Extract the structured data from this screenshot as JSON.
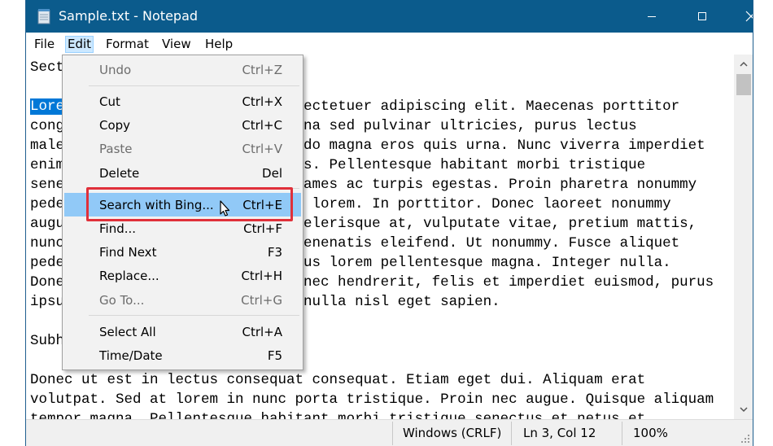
{
  "window": {
    "title": "Sample.txt - Notepad",
    "icon": "notepad-icon",
    "controls": {
      "minimize": "minimize-icon",
      "maximize": "maximize-icon",
      "close": "close-icon"
    }
  },
  "menubar": {
    "items": [
      {
        "label": "File"
      },
      {
        "label": "Edit",
        "active": true
      },
      {
        "label": "Format"
      },
      {
        "label": "View"
      },
      {
        "label": "Help"
      }
    ]
  },
  "editor": {
    "lines": [
      "Sect",
      "",
      "Lorem ipsum dolor sit amet, consectetuer adipiscing elit. Maecenas porttitor",
      "congue massa. Fusce posuere, magna sed pulvinar ultricies, purus lectus",
      "malesuada libero, sit amet commodo magna eros quis urna. Nunc viverra imperdiet",
      "enim. Fusce est. Vivamus a tellus. Pellentesque habitant morbi tristique",
      "senectus et netus et malesuada fames ac turpis egestas. Proin pharetra nonummy",
      "pede. Mauris et orci. Aenean nec lorem. In porttitor. Donec laoreet nonummy",
      "augue. Suspendisse dui purus, scelerisque at, vulputate vitae, pretium mattis,",
      "nunc. Mauris eget neque at sem venenatis eleifend. Ut nonummy. Fusce aliquet",
      "pede non pede. Suspendisse dapibus lorem pellentesque magna. Integer nulla.",
      "Donec blandit feugiat ligula. Donec hendrerit, felis et imperdiet euismod, purus",
      "ipsum pretium metus, in lacinia nulla nisl eget sapien.",
      "",
      "Subh",
      "",
      "Donec ut est in lectus consequat consequat. Etiam eget dui. Aliquam erat",
      "volutpat. Sed at lorem in nunc porta tristique. Proin nec augue. Quisque aliquam",
      "tempor magna. Pellentesque habitant morbi tristique senectus et netus et"
    ],
    "selected_text": "Lore"
  },
  "edit_menu": {
    "items": [
      {
        "label": "Undo",
        "shortcut": "Ctrl+Z",
        "disabled": true
      },
      {
        "label": "Cut",
        "shortcut": "Ctrl+X"
      },
      {
        "label": "Copy",
        "shortcut": "Ctrl+C"
      },
      {
        "label": "Paste",
        "shortcut": "Ctrl+V",
        "disabled": true
      },
      {
        "label": "Delete",
        "shortcut": "Del"
      },
      {
        "label": "Search with Bing...",
        "shortcut": "Ctrl+E",
        "highlighted": true
      },
      {
        "label": "Find...",
        "shortcut": "Ctrl+F"
      },
      {
        "label": "Find Next",
        "shortcut": "F3"
      },
      {
        "label": "Replace...",
        "shortcut": "Ctrl+H"
      },
      {
        "label": "Go To...",
        "shortcut": "Ctrl+G",
        "disabled": true
      },
      {
        "label": "Select All",
        "shortcut": "Ctrl+A"
      },
      {
        "label": "Time/Date",
        "shortcut": "F5"
      }
    ]
  },
  "statusbar": {
    "line_endings": "Windows (CRLF)",
    "position": "Ln 3, Col 12",
    "zoom": "100%"
  },
  "colors": {
    "titlebar": "#0b5b8c",
    "selection": "#0078d7",
    "menu_highlight": "#91c9f7",
    "annotation_box": "#e0303a"
  }
}
